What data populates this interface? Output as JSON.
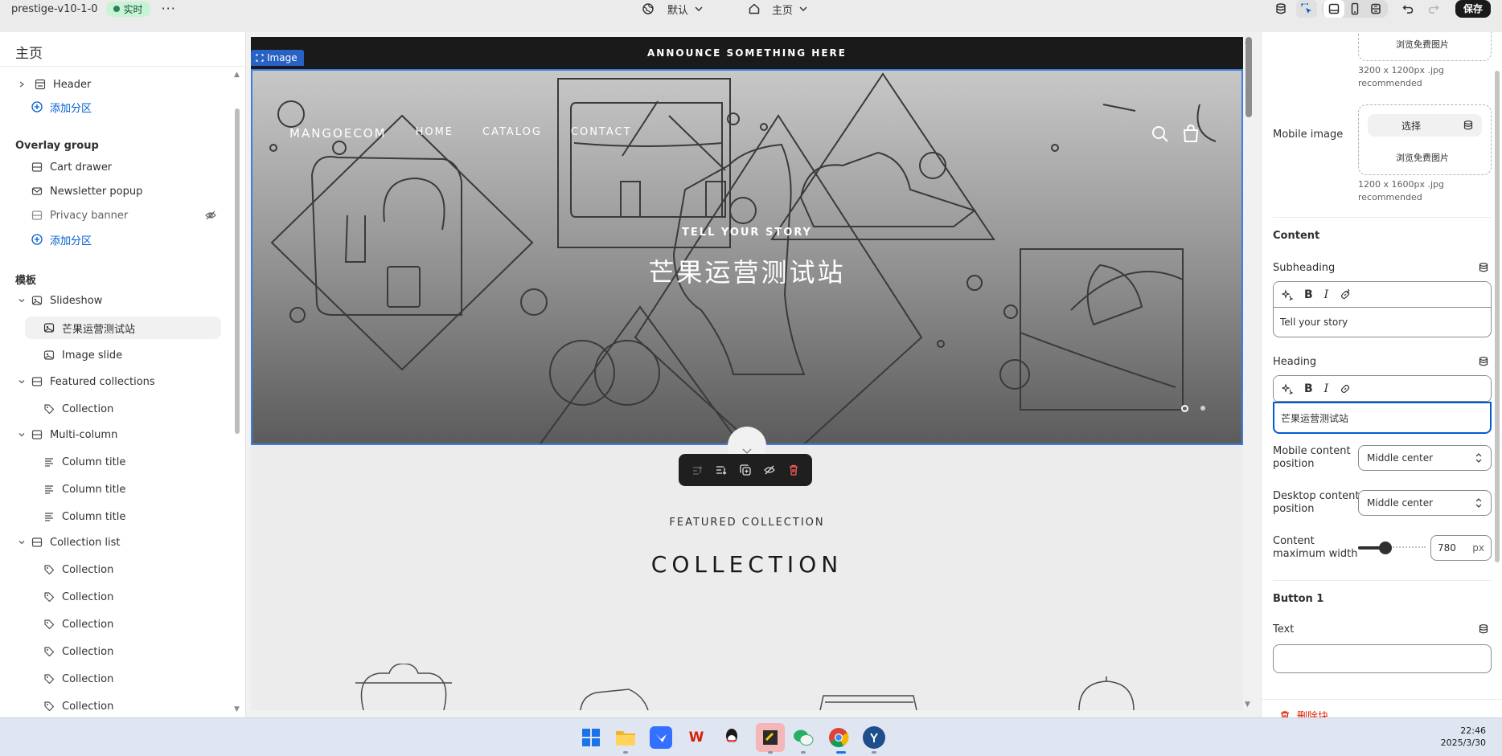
{
  "topbar": {
    "store_name": "prestige-v10-1-0",
    "live_badge": "实时",
    "more_label": "···",
    "theme_label": "默认",
    "page_label": "主页",
    "save_label": "保存"
  },
  "left": {
    "title": "主页",
    "header_item": "Header",
    "add_section": "添加分区",
    "overlay_group_title": "Overlay group",
    "overlay_items": [
      "Cart drawer",
      "Newsletter popup",
      "Privacy banner"
    ],
    "template_title": "模板",
    "slideshow": "Slideshow",
    "slideshow_children": [
      "芒果运营测试站",
      "Image slide"
    ],
    "featured_collections": "Featured collections",
    "featured_child": "Collection",
    "multi_column": "Multi-column",
    "column_titles": [
      "Column title",
      "Column title",
      "Column title"
    ],
    "collection_list": "Collection list",
    "collection_items": [
      "Collection",
      "Collection",
      "Collection",
      "Collection",
      "Collection",
      "Collection"
    ]
  },
  "canvas": {
    "announcement": "ANNOUNCE SOMETHING HERE",
    "image_tag": "Image",
    "store_logo": "MANGOECOM",
    "store_nav": [
      "HOME",
      "CATALOG",
      "CONTACT"
    ],
    "hero_subheading": "TELL YOUR STORY",
    "hero_heading": "芒果运营测试站",
    "featured_subheading": "FEATURED COLLECTION",
    "featured_heading": "COLLECTION"
  },
  "right": {
    "browse_free_1": "浏览免费图片",
    "desktop_rec_1": "3200 x 1200px .jpg",
    "desktop_rec_2": "recommended",
    "mobile_image_label": "Mobile image",
    "select_label": "选择",
    "browse_free_2": "浏览免费图片",
    "mobile_rec_1": "1200 x 1600px .jpg",
    "mobile_rec_2": "recommended",
    "content_title": "Content",
    "subheading_label": "Subheading",
    "subheading_value": "Tell your story",
    "heading_label": "Heading",
    "heading_value": "芒果运营测试站",
    "mobile_pos_label_1": "Mobile content",
    "mobile_pos_label_2": "position",
    "mobile_pos_value": "Middle center",
    "desktop_pos_label_1": "Desktop content",
    "desktop_pos_label_2": "position",
    "desktop_pos_value": "Middle center",
    "max_width_label_1": "Content",
    "max_width_label_2": "maximum width",
    "max_width_value": "780",
    "max_width_unit": "px",
    "max_width_level": 0.4,
    "button1_title": "Button 1",
    "text_label": "Text",
    "text_value": "",
    "delete_block": "删除块"
  },
  "taskbar": {
    "time": "22:46",
    "date": "2025/3/30",
    "apps": [
      "windows-start",
      "file-explorer",
      "feishu",
      "wps",
      "qq",
      "sticky-notes",
      "wechat",
      "chrome",
      "yandex"
    ]
  },
  "colors": {
    "accent": "#005bd3",
    "selection": "#3d7de0",
    "live_green": "#29845a",
    "danger": "#e51c00"
  }
}
